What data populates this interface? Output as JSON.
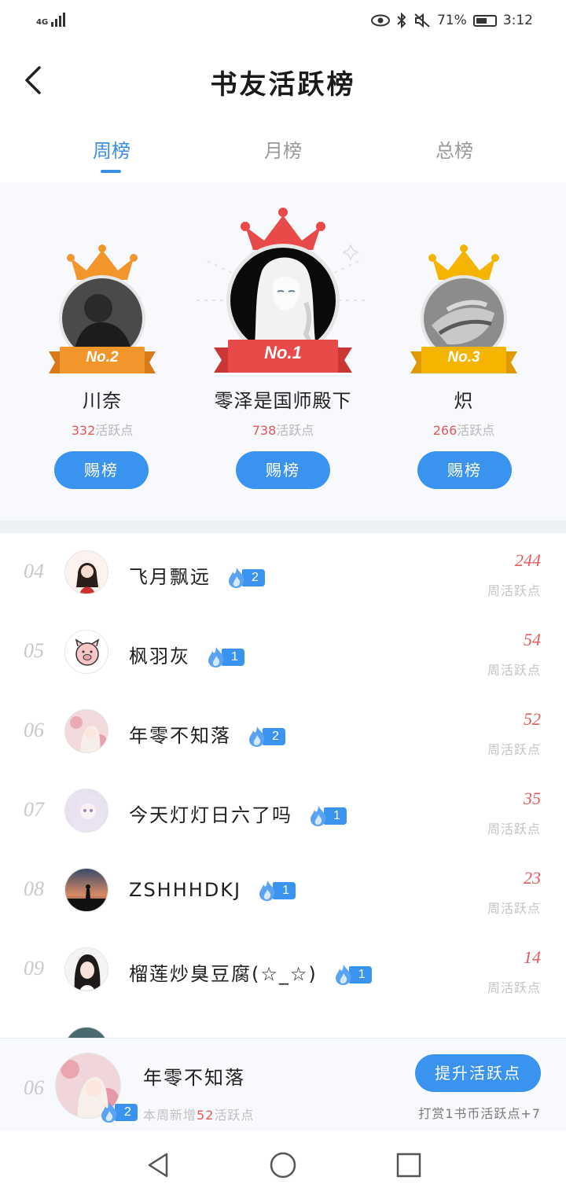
{
  "status_bar": {
    "network": "4G",
    "battery_percent": "71%",
    "time": "3:12"
  },
  "header": {
    "title": "书友活跃榜"
  },
  "tabs": [
    {
      "label": "周榜",
      "active": true
    },
    {
      "label": "月榜",
      "active": false
    },
    {
      "label": "总榜",
      "active": false
    }
  ],
  "podium": [
    {
      "rank_label": "No.1",
      "name": "零泽是国师殿下",
      "points": "738",
      "points_unit": "活跃点",
      "button": "赐榜",
      "color": "#e84a4a"
    },
    {
      "rank_label": "No.2",
      "name": "川奈",
      "points": "332",
      "points_unit": "活跃点",
      "button": "赐榜",
      "color": "#f2952a"
    },
    {
      "rank_label": "No.3",
      "name": "炽",
      "points": "266",
      "points_unit": "活跃点",
      "button": "赐榜",
      "color": "#f5b400"
    }
  ],
  "list": [
    {
      "rank": "04",
      "name": "飞月飘远",
      "level": "2",
      "score": "244",
      "unit": "周活跃点"
    },
    {
      "rank": "05",
      "name": "枫羽灰",
      "level": "1",
      "score": "54",
      "unit": "周活跃点"
    },
    {
      "rank": "06",
      "name": "年零不知落",
      "level": "2",
      "score": "52",
      "unit": "周活跃点"
    },
    {
      "rank": "07",
      "name": "今天灯灯日六了吗",
      "level": "1",
      "score": "35",
      "unit": "周活跃点"
    },
    {
      "rank": "08",
      "name": "ZSHHHDKJ",
      "level": "1",
      "score": "23",
      "unit": "周活跃点"
    },
    {
      "rank": "09",
      "name": "榴莲炒臭豆腐(☆_☆)",
      "level": "1",
      "score": "14",
      "unit": "周活跃点"
    }
  ],
  "my_rank": {
    "rank": "06",
    "name": "年零不知落",
    "level": "2",
    "sub_prefix": "本周新增",
    "sub_points": "52",
    "sub_suffix": "活跃点",
    "button": "提升活跃点",
    "hint": "打赏1书币活跃点+7"
  }
}
